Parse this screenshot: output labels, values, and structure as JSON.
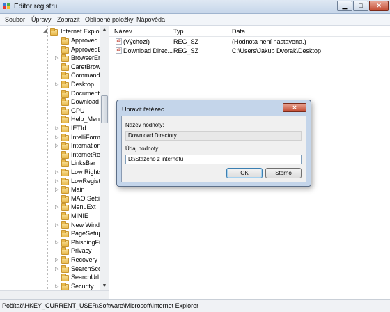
{
  "window": {
    "title": "Editor registru"
  },
  "menu": [
    {
      "label": "Soubor"
    },
    {
      "label": "Úpravy"
    },
    {
      "label": "Zobrazit"
    },
    {
      "label": "Oblíbené položky"
    },
    {
      "label": "Nápověda"
    }
  ],
  "tree": {
    "root_label": "Internet Explor",
    "items": [
      {
        "label": "Approved I",
        "expander": ""
      },
      {
        "label": "ApprovedE",
        "expander": ""
      },
      {
        "label": "BrowserEm",
        "expander": "▷"
      },
      {
        "label": "CaretBrows",
        "expander": ""
      },
      {
        "label": "Command",
        "expander": ""
      },
      {
        "label": "Desktop",
        "expander": "▷"
      },
      {
        "label": "Document",
        "expander": ""
      },
      {
        "label": "Download",
        "expander": ""
      },
      {
        "label": "GPU",
        "expander": ""
      },
      {
        "label": "Help_Menu",
        "expander": ""
      },
      {
        "label": "IETId",
        "expander": "▷"
      },
      {
        "label": "IntelliForm",
        "expander": "▷"
      },
      {
        "label": "Internation",
        "expander": "▷"
      },
      {
        "label": "InternetReg",
        "expander": ""
      },
      {
        "label": "LinksBar",
        "expander": ""
      },
      {
        "label": "Low Rights",
        "expander": "▷"
      },
      {
        "label": "LowRegistr",
        "expander": "▷"
      },
      {
        "label": "Main",
        "expander": "▷"
      },
      {
        "label": "MAO Settin",
        "expander": ""
      },
      {
        "label": "MenuExt",
        "expander": "▷"
      },
      {
        "label": "MINIE",
        "expander": ""
      },
      {
        "label": "New Windo",
        "expander": "▷"
      },
      {
        "label": "PageSetup",
        "expander": ""
      },
      {
        "label": "PhishingFil",
        "expander": "▷"
      },
      {
        "label": "Privacy",
        "expander": ""
      },
      {
        "label": "Recovery",
        "expander": "▷"
      },
      {
        "label": "SearchScop",
        "expander": "▷"
      },
      {
        "label": "SearchUrl",
        "expander": ""
      },
      {
        "label": "Security",
        "expander": "▷"
      }
    ]
  },
  "list": {
    "columns": [
      "Název",
      "Typ",
      "Data"
    ],
    "rows": [
      {
        "name": "(Výchozí)",
        "type": "REG_SZ",
        "data": "(Hodnota není nastavena.)"
      },
      {
        "name": "Download Direc...",
        "type": "REG_SZ",
        "data": "C:\\Users\\Jakub Dvorak\\Desktop"
      }
    ]
  },
  "dialog": {
    "title": "Upravit řetězec",
    "name_label": "Název hodnoty:",
    "name_value": "Download Directory",
    "data_label": "Údaj hodnoty:",
    "data_value": "D:\\Staženo z internetu",
    "ok_label": "OK",
    "cancel_label": "Storno"
  },
  "statusbar": {
    "path": "Počítač\\HKEY_CURRENT_USER\\Software\\Microsoft\\Internet Explorer"
  },
  "icons": {
    "app": "registry-editor-icon",
    "folder": "folder-icon",
    "value": "string-value-icon"
  }
}
